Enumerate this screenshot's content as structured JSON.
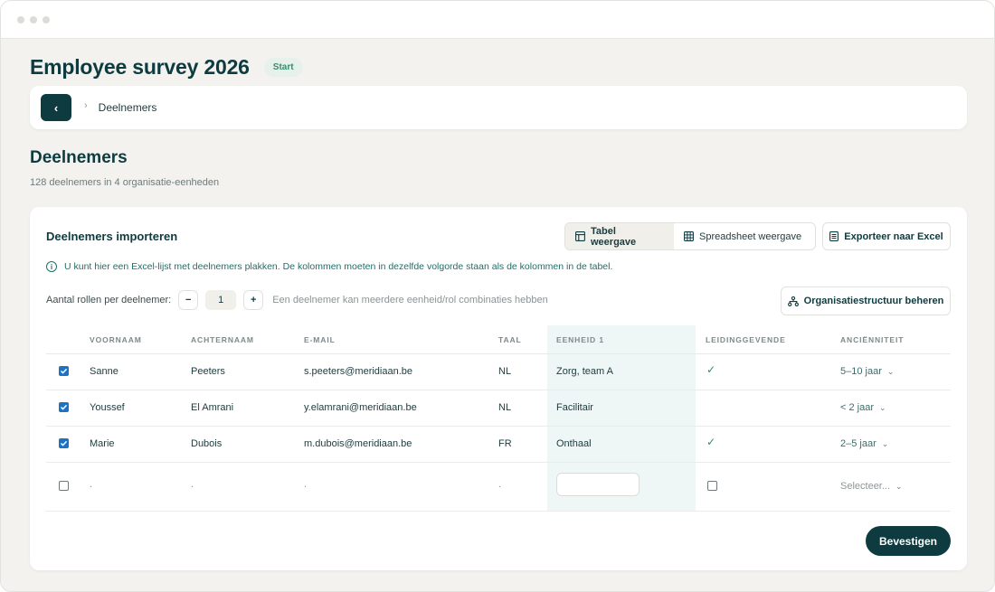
{
  "page": {
    "title": "Employee survey 2026",
    "status": "Start"
  },
  "breadcrumb": {
    "current": "Deelnemers"
  },
  "section": {
    "title": "Deelnemers",
    "subtitle": "128 deelnemers in 4 organisatie-eenheden"
  },
  "import_card": {
    "title": "Deelnemers importeren",
    "views": [
      "Tabel weergave",
      "Spreadsheet weergave"
    ],
    "active_view": "Tabel weergave",
    "export_label": "Exporteer naar Excel",
    "info": "U kunt hier een Excel-lijst met deelnemers plakken. De kolommen moeten in dezelfde volgorde staan als de kolommen in de tabel.",
    "roles_label": "Aantal rollen per deelnemer:",
    "roles_value": "1",
    "roles_minus": "−",
    "roles_plus": "+",
    "roles_hint": "Een deelnemer kan meerdere eenheid/rol combinaties hebben",
    "org_button": "Organisatiestructuur beheren",
    "confirm_label": "Bevestigen"
  },
  "table": {
    "columns": [
      "VOORNAAM",
      "ACHTERNAAM",
      "E-MAIL",
      "TAAL",
      "EENHEID 1",
      "LEIDINGGEVENDE",
      "ANCIËNNITEIT"
    ],
    "rows": [
      {
        "checked": true,
        "first": "Sanne",
        "last": "Peeters",
        "email": "s.peeters@meridiaan.be",
        "lang": "NL",
        "unit": "Zorg, team A",
        "manager": true,
        "seniority": "5–10 jaar"
      },
      {
        "checked": true,
        "first": "Youssef",
        "last": "El Amrani",
        "email": "y.elamrani@meridiaan.be",
        "lang": "NL",
        "unit": "Facilitair",
        "manager": false,
        "seniority": "< 2 jaar"
      },
      {
        "checked": true,
        "first": "Marie",
        "last": "Dubois",
        "email": "m.dubois@meridiaan.be",
        "lang": "FR",
        "unit": "Onthaal",
        "manager": true,
        "seniority": "2–5 jaar"
      }
    ],
    "empty_row": {
      "first": ".",
      "last": ".",
      "email": ".",
      "lang": ".",
      "seniority_placeholder": "Selecteer..."
    }
  },
  "colors": {
    "primary": "#0d3b3f",
    "accent_check": "#2f8b6c",
    "checkbox": "#1a73c9",
    "highlight_col": "#eef6f6",
    "info_text": "#1f6e6a"
  }
}
